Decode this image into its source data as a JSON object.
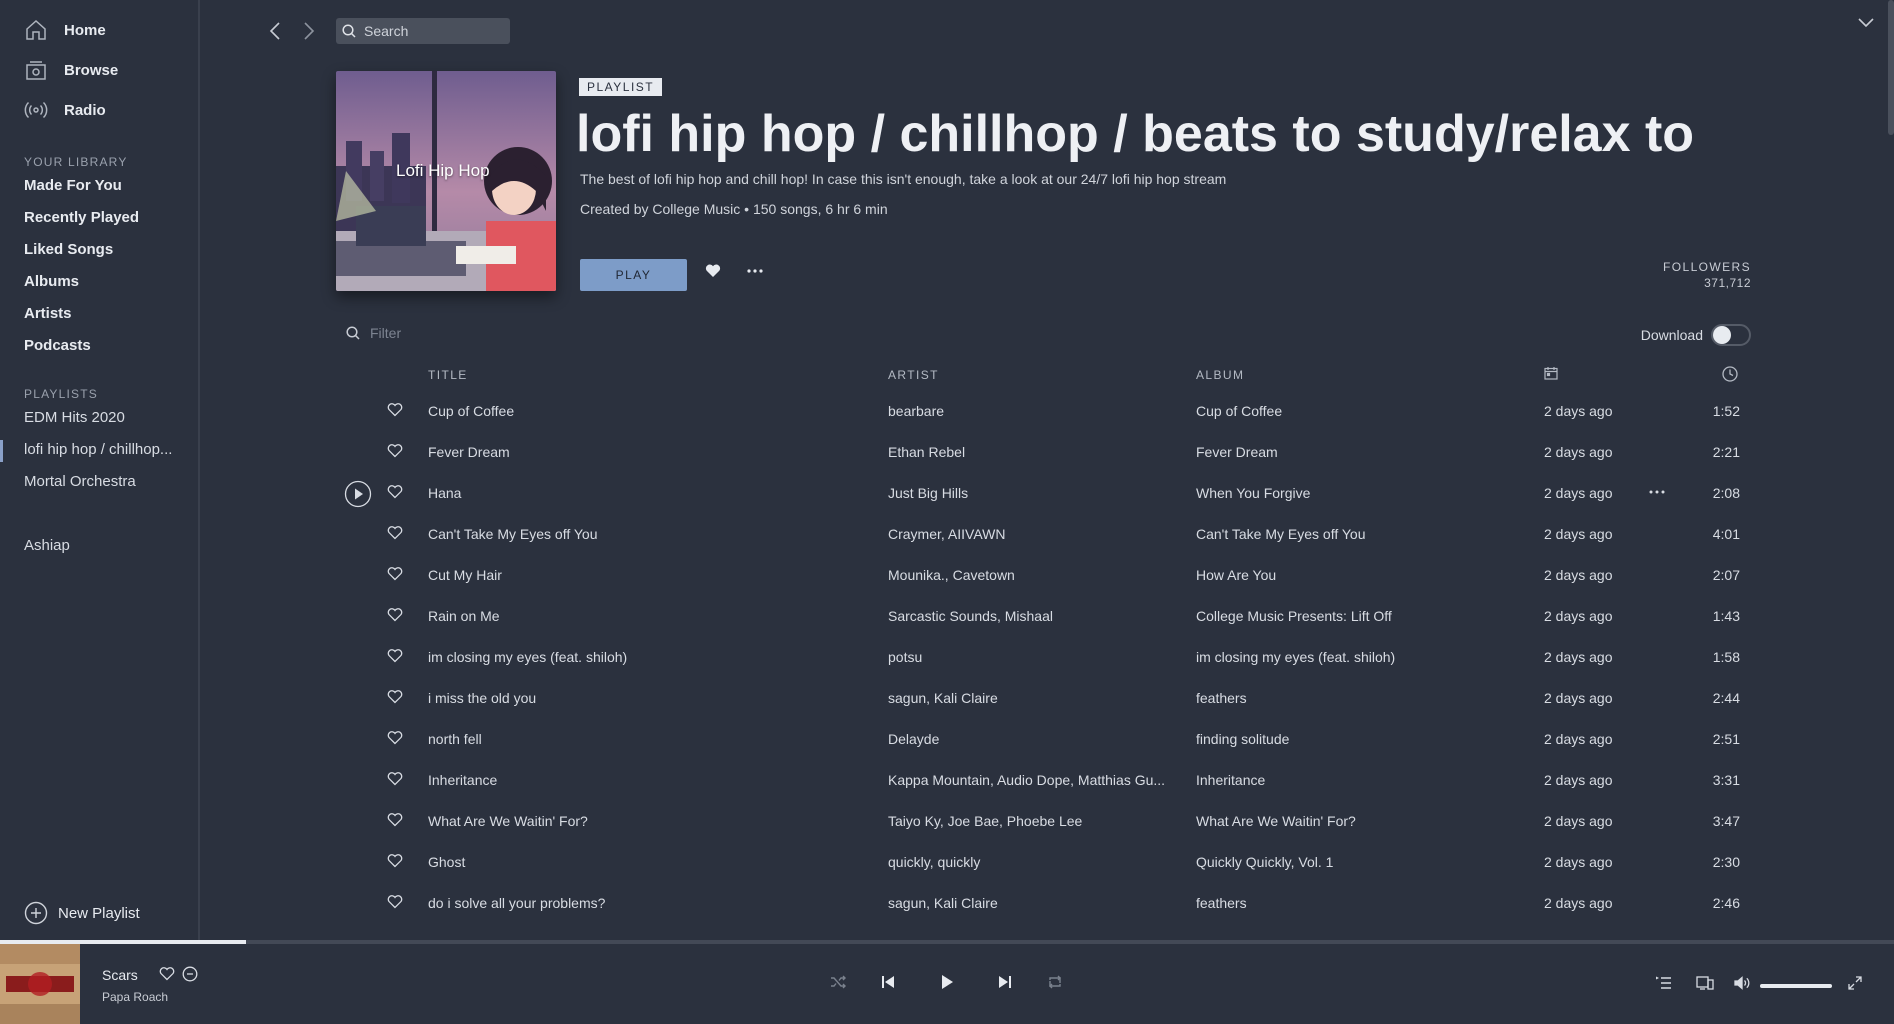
{
  "sidebar": {
    "nav": [
      {
        "label": "Home",
        "icon": "home-icon"
      },
      {
        "label": "Browse",
        "icon": "browse-icon"
      },
      {
        "label": "Radio",
        "icon": "radio-icon"
      }
    ],
    "library_title": "YOUR LIBRARY",
    "library": [
      "Made For You",
      "Recently Played",
      "Liked Songs",
      "Albums",
      "Artists",
      "Podcasts"
    ],
    "playlists_title": "PLAYLISTS",
    "playlists": [
      "EDM Hits 2020",
      "lofi hip hop / chillhop...",
      "Mortal Orchestra"
    ],
    "active_playlist_index": 1,
    "user": "Ashiap",
    "new_playlist": "New Playlist"
  },
  "topbar": {
    "search_placeholder": "Search"
  },
  "header": {
    "cover_text": "Lofi Hip Hop",
    "badge": "PLAYLIST",
    "title": "lofi hip hop / chillhop / beats to study/relax to",
    "description": "The best of lofi hip hop and chill hop! In case this isn't enough, take a look at our 24/7 lofi hip hop stream",
    "meta": "Created by College Music • 150 songs, 6 hr 6 min",
    "play_label": "PLAY",
    "followers_label": "FOLLOWERS",
    "followers_count": "371,712"
  },
  "filter": {
    "placeholder": "Filter",
    "download_label": "Download",
    "download_on": false
  },
  "table": {
    "headers": {
      "title": "TITLE",
      "artist": "ARTIST",
      "album": "ALBUM"
    },
    "hover_row_index": 2,
    "tracks": [
      {
        "title": "Cup of Coffee",
        "artist": "bearbare",
        "album": "Cup of Coffee",
        "added": "2 days ago",
        "duration": "1:52"
      },
      {
        "title": "Fever Dream",
        "artist": "Ethan Rebel",
        "album": "Fever Dream",
        "added": "2 days ago",
        "duration": "2:21"
      },
      {
        "title": "Hana",
        "artist": "Just Big Hills",
        "album": "When You Forgive",
        "added": "2 days ago",
        "duration": "2:08"
      },
      {
        "title": "Can't Take My Eyes off You",
        "artist": "Craymer, AIIVAWN",
        "album": "Can't Take My Eyes off You",
        "added": "2 days ago",
        "duration": "4:01"
      },
      {
        "title": "Cut My Hair",
        "artist": "Mounika., Cavetown",
        "album": "How Are You",
        "added": "2 days ago",
        "duration": "2:07"
      },
      {
        "title": "Rain on Me",
        "artist": "Sarcastic Sounds, Mishaal",
        "album": "College Music Presents: Lift Off",
        "added": "2 days ago",
        "duration": "1:43"
      },
      {
        "title": "im closing my eyes (feat. shiloh)",
        "artist": "potsu",
        "album": "im closing my eyes (feat. shiloh)",
        "added": "2 days ago",
        "duration": "1:58"
      },
      {
        "title": "i miss the old you",
        "artist": "sagun, Kali Claire",
        "album": "feathers",
        "added": "2 days ago",
        "duration": "2:44"
      },
      {
        "title": "north fell",
        "artist": "Delayde",
        "album": "finding solitude",
        "added": "2 days ago",
        "duration": "2:51"
      },
      {
        "title": "Inheritance",
        "artist": "Kappa Mountain, Audio Dope, Matthias Gu...",
        "album": "Inheritance",
        "added": "2 days ago",
        "duration": "3:31"
      },
      {
        "title": "What Are We Waitin' For?",
        "artist": "Taiyo Ky, Joe Bae, Phoebe Lee",
        "album": "What Are We Waitin' For?",
        "added": "2 days ago",
        "duration": "3:47"
      },
      {
        "title": "Ghost",
        "artist": "quickly, quickly",
        "album": "Quickly Quickly, Vol. 1",
        "added": "2 days ago",
        "duration": "2:30"
      },
      {
        "title": "do i solve all your problems?",
        "artist": "sagun, Kali Claire",
        "album": "feathers",
        "added": "2 days ago",
        "duration": "2:46"
      }
    ]
  },
  "player": {
    "title": "Scars",
    "artist": "Papa Roach",
    "progress_fraction": 0.13,
    "volume_fraction": 1.0
  },
  "colors": {
    "background": "#2b313e",
    "accent": "#7d9cc8",
    "text": "#d8dce3"
  }
}
